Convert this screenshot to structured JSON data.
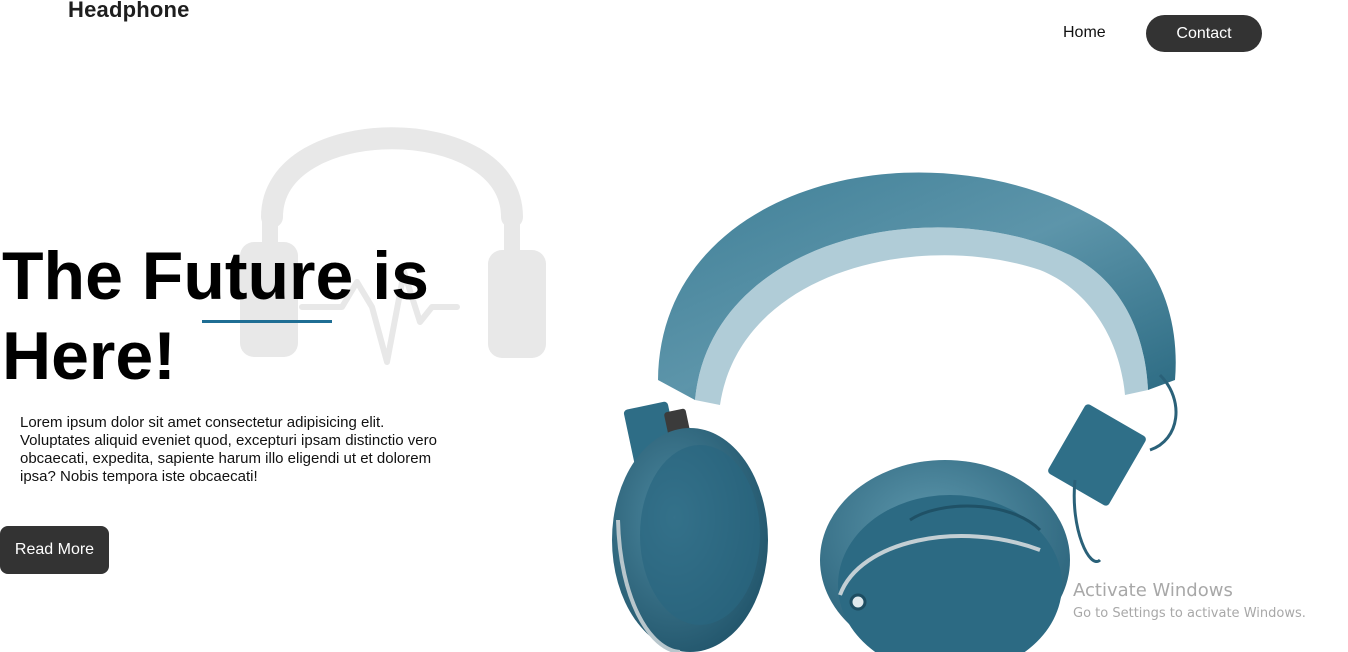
{
  "header": {
    "brand": "Headphone",
    "nav": {
      "home_label": "Home",
      "contact_label": "Contact"
    }
  },
  "hero": {
    "title_line1": "The Future is",
    "title_line2": "Here!",
    "description": "Lorem ipsum dolor sit amet consectetur adipisicing elit. Voluptates aliquid eveniet quod, excepturi ipsam distinctio vero obcaecati, expedita, sapiente harum illo eligendi ut et dolorem ipsa? Nobis tempora iste obcaecati!",
    "cta_label": "Read More"
  },
  "overlay": {
    "activate_title": "Activate Windows",
    "activate_subtitle": "Go to Settings to activate Windows."
  },
  "colors": {
    "accent_underline": "#1f6e94",
    "button_dark": "#333333",
    "headphone_teal": "#2a6a82",
    "watermark_logo": "#e8e8e8"
  },
  "icons": {
    "background_logo": "headphone-pulse-icon",
    "product": "headphones-product-image"
  }
}
